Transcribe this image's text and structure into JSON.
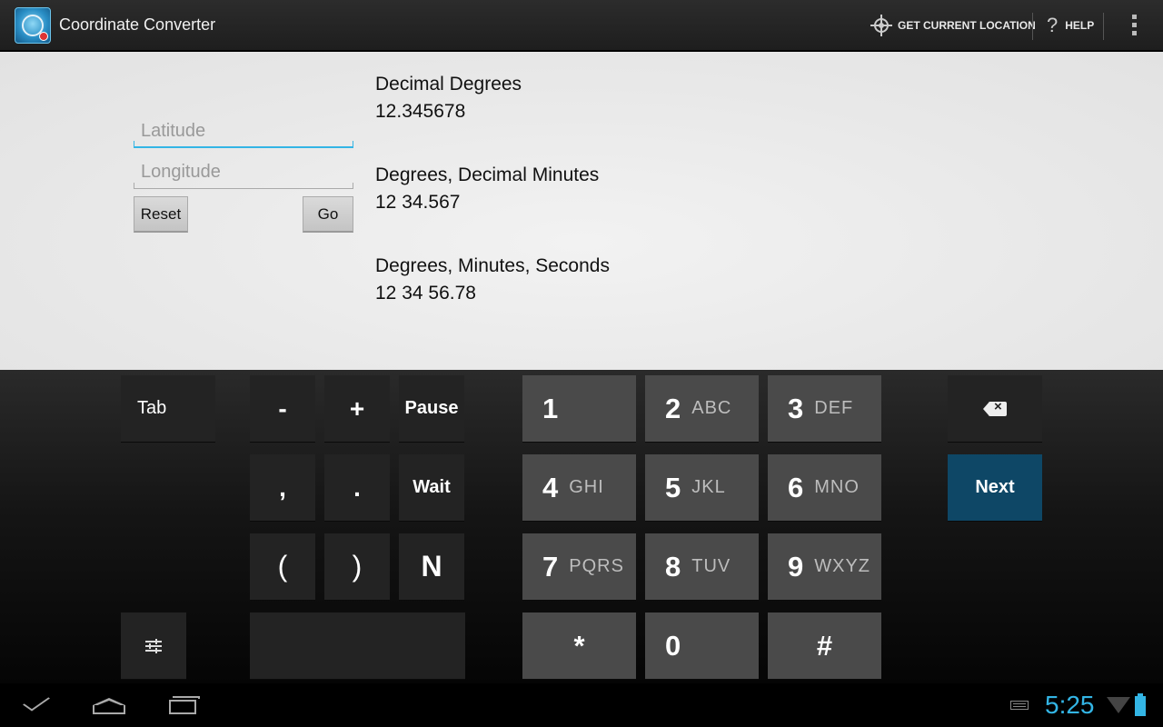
{
  "actionbar": {
    "title": "Coordinate Converter",
    "get_location_label": "GET CURRENT LOCATION",
    "help_label": "HELP"
  },
  "inputs": {
    "latitude_placeholder": "Latitude",
    "longitude_placeholder": "Longitude",
    "reset_label": "Reset",
    "go_label": "Go"
  },
  "results": {
    "dd_label": "Decimal Degrees",
    "dd_value": "12.345678",
    "ddm_label": "Degrees, Decimal Minutes",
    "ddm_value": "12 34.567",
    "dms_label": "Degrees, Minutes, Seconds",
    "dms_value": "12 34 56.78"
  },
  "keyboard": {
    "tab": "Tab",
    "minus": "-",
    "plus": "+",
    "pause": "Pause",
    "comma": ",",
    "period": ".",
    "wait": "Wait",
    "lparen": "(",
    "rparen": ")",
    "n": "N",
    "next": "Next",
    "numpad": [
      {
        "digit": "1",
        "letters": ""
      },
      {
        "digit": "2",
        "letters": "ABC"
      },
      {
        "digit": "3",
        "letters": "DEF"
      },
      {
        "digit": "4",
        "letters": "GHI"
      },
      {
        "digit": "5",
        "letters": "JKL"
      },
      {
        "digit": "6",
        "letters": "MNO"
      },
      {
        "digit": "7",
        "letters": "PQRS"
      },
      {
        "digit": "8",
        "letters": "TUV"
      },
      {
        "digit": "9",
        "letters": "WXYZ"
      }
    ],
    "star": "*",
    "zero": "0",
    "hash": "#"
  },
  "statusbar": {
    "time": "5:25"
  },
  "colors": {
    "accent": "#33b5e5",
    "next_key": "#0e4766",
    "numpad_key": "#4a4a4a"
  }
}
